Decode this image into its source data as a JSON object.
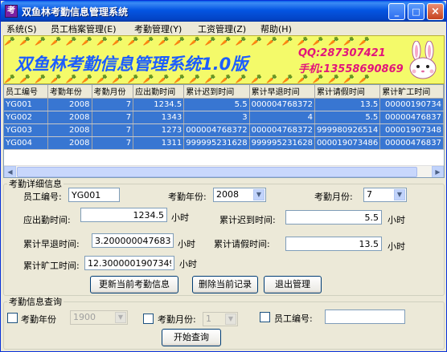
{
  "window": {
    "title": "双鱼林考勤信息管理系统"
  },
  "titlebar_buttons": {
    "minimize": "_",
    "maximize": "□",
    "close": "×"
  },
  "menu": [
    "系统(S)",
    "员工档案管理(E)",
    "考勤管理(Y)",
    "工资管理(Z)",
    "帮助(H)"
  ],
  "banner": {
    "title": "双鱼林考勤信息管理系统1.0版",
    "qq": "QQ:287307421",
    "phone": "手机:13558690869",
    "decoration": "carrot-pattern",
    "mascot": "bunny-icon"
  },
  "grid": {
    "columns": [
      "员工编号",
      "考勤年份",
      "考勤月份",
      "应出勤时间",
      "累计迟到时间",
      "累计早退时间",
      "累计请假时间",
      "累计旷工时间"
    ],
    "rows": [
      [
        "YG001",
        "2008",
        "7",
        "1234.5",
        "5.5",
        "000004768372",
        "13.5",
        "00000190734"
      ],
      [
        "YG002",
        "2008",
        "7",
        "1343",
        "3",
        "4",
        "5.5",
        "00000476837"
      ],
      [
        "YG003",
        "2008",
        "7",
        "1273",
        "000004768372",
        "000004768372",
        "999980926514",
        "00001907348"
      ],
      [
        "YG004",
        "2008",
        "7",
        "1311",
        "999995231628",
        "999995231628",
        "000019073486",
        "00000476837"
      ]
    ],
    "row_color": "#3876d2"
  },
  "detail": {
    "legend": "考勤详细信息",
    "employee_id_label": "员工编号:",
    "employee_id_value": "YG001",
    "year_label": "考勤年份:",
    "year_value": "2008",
    "month_label": "考勤月份:",
    "month_value": "7",
    "attendance_label": "应出勤时间:",
    "attendance_value": "1234.5",
    "late_label": "累计迟到时间:",
    "late_value": "5.5",
    "early_label": "累计早退时间:",
    "early_value": "3.20000004768372",
    "leave_label": "累计请假时间:",
    "leave_value": "13.5",
    "absent_label": "累计旷工时间:",
    "absent_value": "12.3000001907349",
    "hour_unit": "小时",
    "update_button": "更新当前考勤信息",
    "delete_button": "删除当前记录",
    "exit_button": "退出管理"
  },
  "query": {
    "legend": "考勤信息查询",
    "year_label": "考勤年份",
    "year_value": "1900",
    "month_label": "考勤月份:",
    "month_value": "1",
    "employee_label": "员工编号:",
    "employee_value": "",
    "search_button": "开始查询"
  }
}
